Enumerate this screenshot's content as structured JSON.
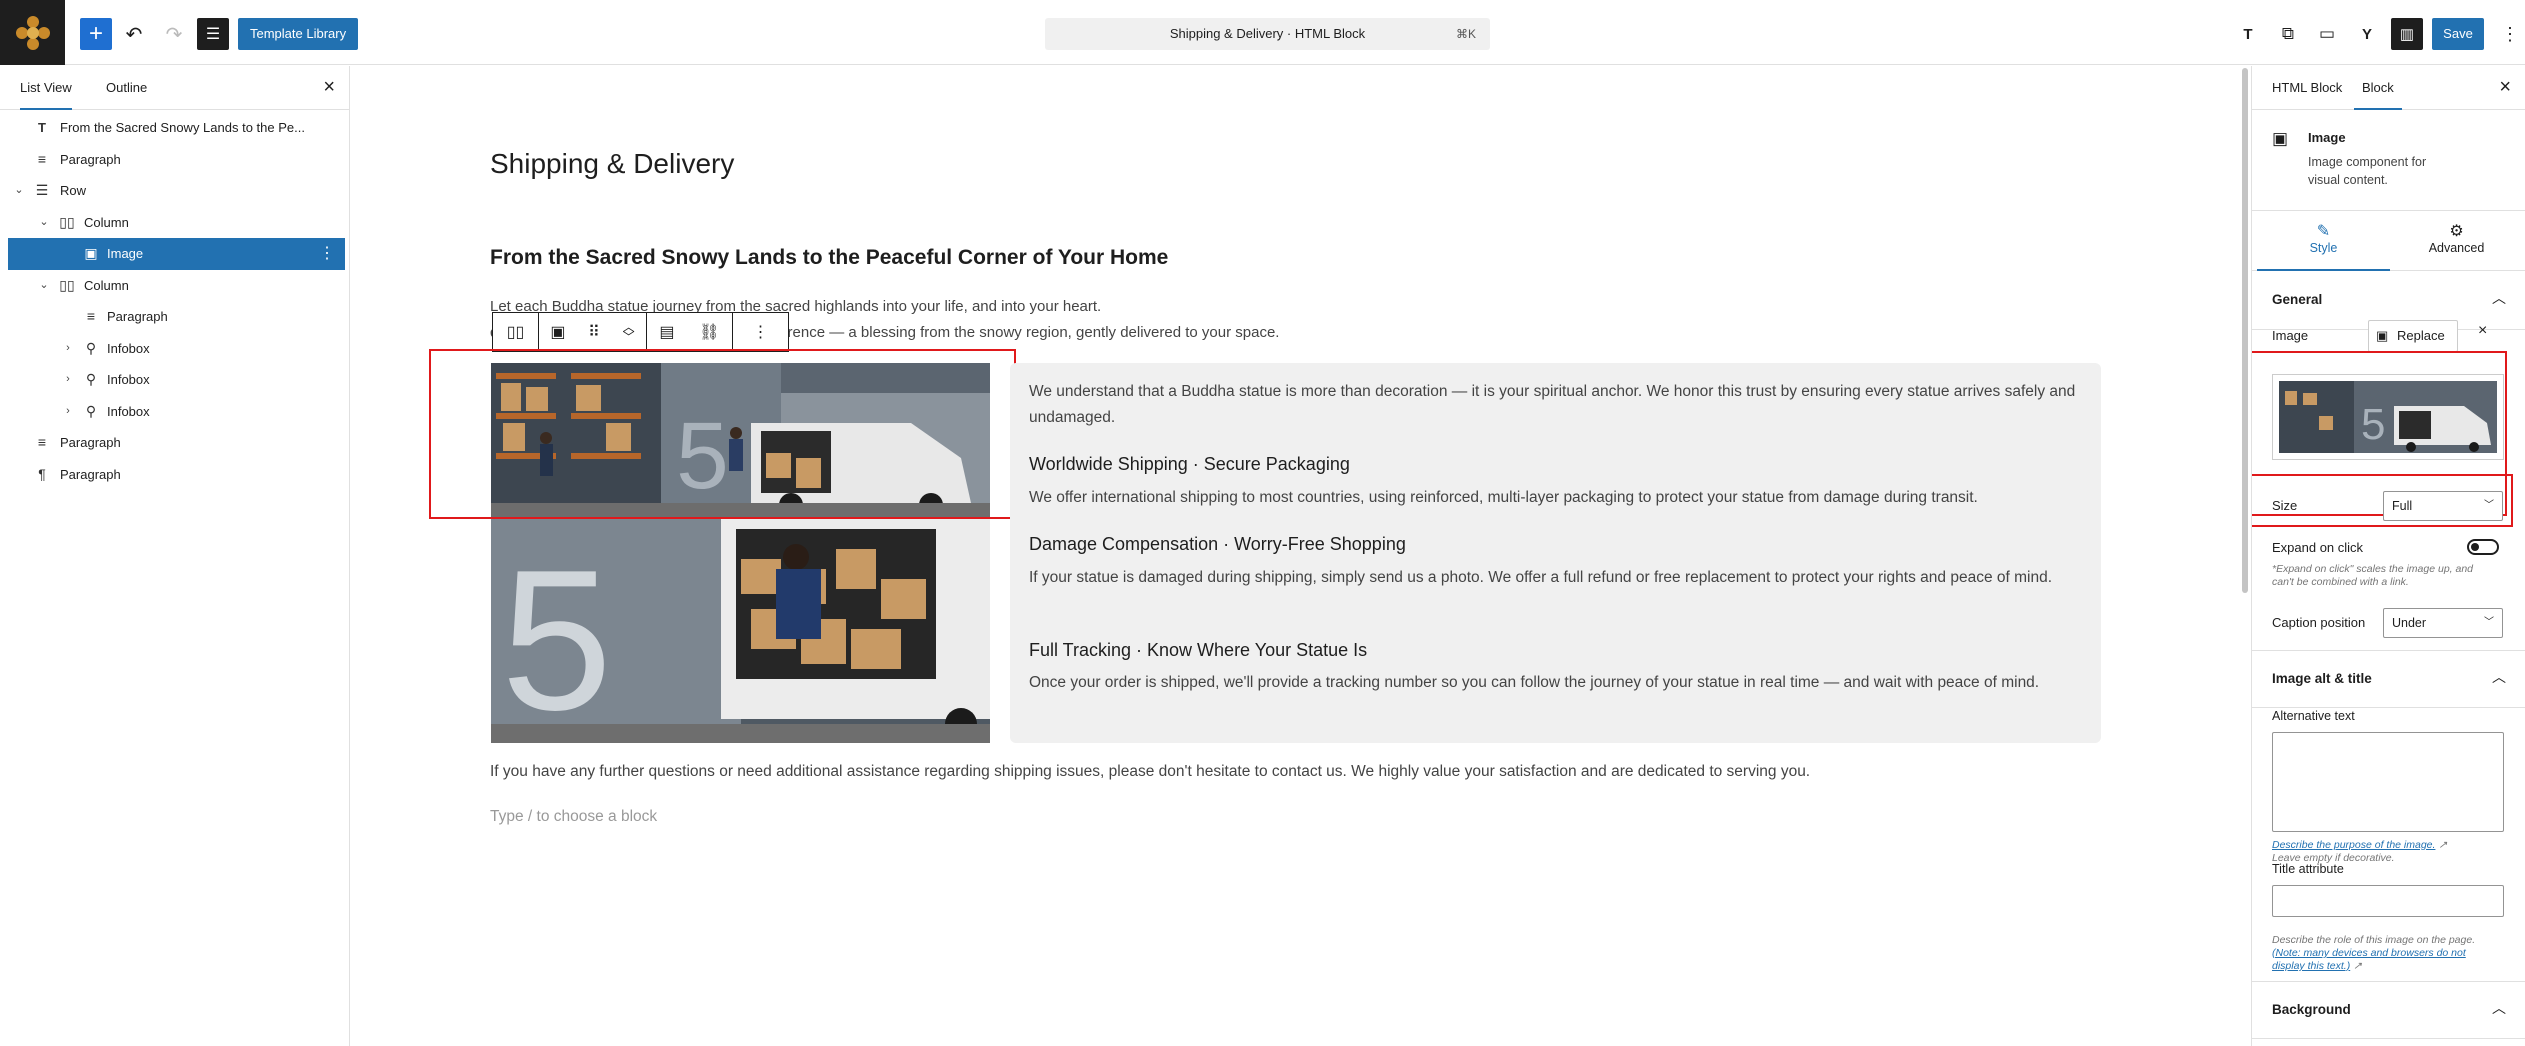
{
  "topbar": {
    "template_library_label": "Template Library",
    "document_title": "Shipping & Delivery · HTML Block",
    "command_shortcut": "⌘K",
    "save_label": "Save",
    "text_icon_label": "T"
  },
  "left_panel": {
    "tabs": [
      "List View",
      "Outline"
    ],
    "items": [
      {
        "label": "From the Sacred Snowy Lands to the Pe...",
        "icon": "heading-icon",
        "depth": 0,
        "expanded": null
      },
      {
        "label": "Paragraph",
        "icon": "paragraph-icon",
        "depth": 0,
        "expanded": null
      },
      {
        "label": "Row",
        "icon": "row-icon",
        "depth": 0,
        "expanded": true
      },
      {
        "label": "Column",
        "icon": "column-icon",
        "depth": 1,
        "expanded": true
      },
      {
        "label": "Image",
        "icon": "image-icon",
        "depth": 2,
        "expanded": null,
        "selected": true
      },
      {
        "label": "Column",
        "icon": "column-icon",
        "depth": 1,
        "expanded": true
      },
      {
        "label": "Paragraph",
        "icon": "paragraph-icon",
        "depth": 2,
        "expanded": null
      },
      {
        "label": "Infobox",
        "icon": "infobox-icon",
        "depth": 2,
        "expanded": false
      },
      {
        "label": "Infobox",
        "icon": "infobox-icon",
        "depth": 2,
        "expanded": false
      },
      {
        "label": "Infobox",
        "icon": "infobox-icon",
        "depth": 2,
        "expanded": false
      },
      {
        "label": "Paragraph",
        "icon": "paragraph-icon",
        "depth": 0,
        "expanded": null
      },
      {
        "label": "Paragraph",
        "icon": "pilcrow-icon",
        "depth": 0,
        "expanded": null
      }
    ]
  },
  "canvas": {
    "page_title": "Shipping & Delivery",
    "heading": "From the Sacred Snowy Lands to the Peaceful Corner of Your Home",
    "intro_line1": "Let each Buddha statue journey from the sacred highlands into your life, and into your heart.",
    "intro_line2_prefix": "d",
    "intro_line2_suffix": "ith reverence — a blessing from the snowy region, gently delivered to your space.",
    "card_intro": "We understand that a Buddha statue is more than decoration — it is your spiritual anchor. We honor this trust by ensuring every statue arrives safely and undamaged.",
    "features": [
      {
        "title": "Worldwide Shipping · Secure Packaging",
        "text": "We offer international shipping to most countries, using reinforced, multi-layer packaging to protect your statue from damage during transit."
      },
      {
        "title": "Damage Compensation · Worry-Free Shopping",
        "text": "If your statue is damaged during shipping, simply send us a photo. We offer a full refund or free replacement to protect your rights and peace of mind."
      },
      {
        "title": "Full Tracking · Know Where Your Statue Is",
        "text": "Once your order is shipped, we'll provide a tracking number so you can follow the journey of your statue in real time — and wait with peace of mind."
      }
    ],
    "closing": "If you have any further questions or need additional assistance regarding shipping issues, please don't hesitate to contact us. We highly value your satisfaction and are dedicated to serving you.",
    "block_placeholder": "Type / to choose a block"
  },
  "right_panel": {
    "tabs": [
      "HTML Block",
      "Block"
    ],
    "block_name": "Image",
    "block_desc_line1": "Image component for",
    "block_desc_line2": "visual content.",
    "style_tab": "Style",
    "advanced_tab": "Advanced",
    "general_title": "General",
    "image_label": "Image",
    "replace_label": "Replace",
    "size_label": "Size",
    "size_value": "Full",
    "expand_label": "Expand on click",
    "expand_on": false,
    "expand_help_line1": "*Expand on click\" scales the image up, and",
    "expand_help_line2": "can't be combined with a link.",
    "caption_label": "Caption position",
    "caption_value": "Under",
    "alt_section_title": "Image alt & title",
    "alt_label": "Alternative text",
    "alt_value": "",
    "alt_help_link": "Describe the purpose of the image.",
    "alt_help_text": "Leave empty if decorative.",
    "title_label": "Title attribute",
    "title_value": "",
    "title_help_line1": "Describe the role of this image on the page.",
    "title_help_link1": "(Note: many devices and browsers do not",
    "title_help_link2": "display this text.)",
    "background_title": "Background"
  },
  "colors": {
    "accent": "#2271b1",
    "highlight": "#e0191b",
    "card_bg": "#f0f0f0"
  }
}
